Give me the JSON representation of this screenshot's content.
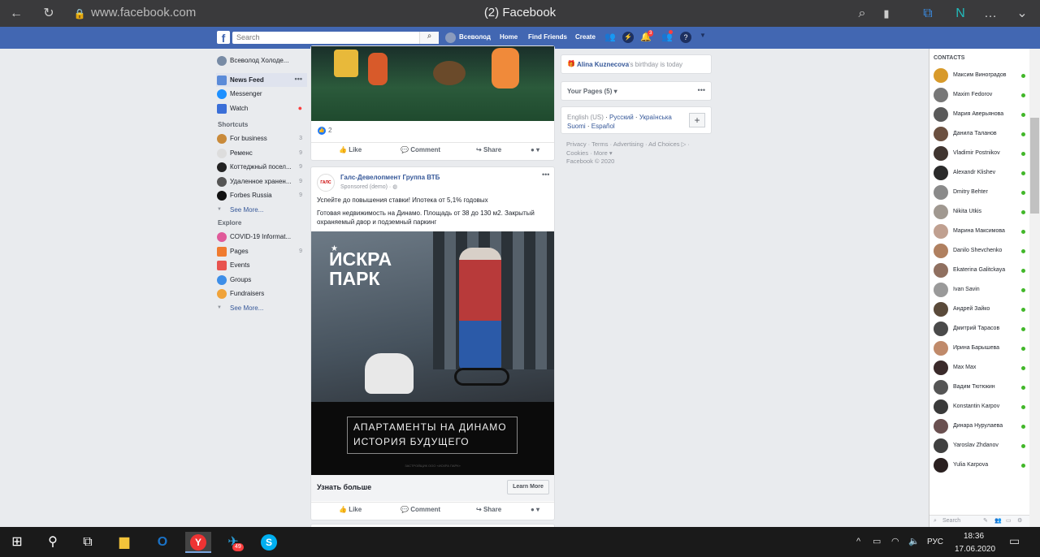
{
  "browser": {
    "url": "www.facebook.com",
    "title": "(2) Facebook"
  },
  "topbar": {
    "search_placeholder": "Search",
    "profile": "Всеволод",
    "home": "Home",
    "find_friends": "Find Friends",
    "create": "Create",
    "msg_badge": "1",
    "notif_badge": "3"
  },
  "left_nav": {
    "profile_name": "Всеволод Холоде...",
    "main": [
      {
        "label": "News Feed",
        "icon": "news-feed-icon"
      },
      {
        "label": "Messenger",
        "icon": "messenger-icon"
      },
      {
        "label": "Watch",
        "icon": "watch-icon"
      }
    ],
    "shortcuts_title": "Shortcuts",
    "shortcuts": [
      {
        "label": "For business",
        "count": "3"
      },
      {
        "label": "Ременс",
        "count": "9"
      },
      {
        "label": "Коттеджный посел...",
        "count": "9"
      },
      {
        "label": "Удаленное хранен...",
        "count": "9"
      },
      {
        "label": "Forbes Russia",
        "count": "9"
      }
    ],
    "see_more": "See More...",
    "explore_title": "Explore",
    "explore": [
      {
        "label": "COVID-19 Informat...",
        "count": ""
      },
      {
        "label": "Pages",
        "count": "9"
      },
      {
        "label": "Events",
        "count": ""
      },
      {
        "label": "Groups",
        "count": ""
      },
      {
        "label": "Fundraisers",
        "count": ""
      }
    ],
    "see_more2": "See More..."
  },
  "post1": {
    "reactions": "2",
    "like": "Like",
    "comment": "Comment",
    "share": "Share"
  },
  "post2": {
    "page_name": "Галс-Девелопмент Группа ВТБ",
    "sponsored": "Sponsored (demo) ·",
    "text1": "Успейте до повышения ставки! Ипотека от 5,1% годовых",
    "text2": "Готовая недвижимость на Динамо. Площадь от 38 до 130 м2. Закрытый охраняемый двор и подземный паркинг",
    "ad_logo": "ИСКРА ПАРК",
    "ad_caption1": "АПАРТАМЕНТЫ НА ДИНАМО",
    "ad_caption2": "ИСТОРИЯ БУДУЩЕГО",
    "ad_footnote": "ЗАСТРОЙЩИК ООО «ИСКРА ПАРК»",
    "cta_text": "Узнать больше",
    "cta_button": "Learn More",
    "like": "Like",
    "comment": "Comment",
    "share": "Share"
  },
  "right": {
    "birthday_name": "Alina Kuznecova",
    "birthday_text": "'s birthday is today",
    "your_pages": "Your Pages (5)",
    "langs": [
      "English (US)",
      "Русский",
      "Українська",
      "Suomi",
      "Español"
    ],
    "footer_links": "Privacy · Terms · Advertising · Ad Choices ▷ · Cookies · More ▾",
    "copyright": "Facebook © 2020"
  },
  "contacts": {
    "title": "CONTACTS",
    "list": [
      "Максим Виноградов",
      "Maxim Fedorov",
      "Мария Аверьянова",
      "Данила Таланов",
      "Vladimir Postnikov",
      "Alexandr Klishev",
      "Dmitry Behter",
      "Nikita Utkis",
      "Марина Максимова",
      "Danilo Shevchenko",
      "Ekaterina Galitckaya",
      "Ivan Savin",
      "Андрей Зайко",
      "Дмитрий Тарасов",
      "Ирина Барышева",
      "Max Max",
      "Вадим Тютюкин",
      "Konstantin Karpov",
      "Динара Нурулаева",
      "Yaroslav Zhdanov",
      "Yulia Karpova"
    ],
    "search": "Search"
  },
  "taskbar": {
    "lang": "РУС",
    "time": "18:36",
    "date": "17.06.2020",
    "telegram_badge": "49"
  },
  "colors": {
    "fb_blue": "#4267b2",
    "link": "#365899",
    "online": "#42b72a"
  }
}
